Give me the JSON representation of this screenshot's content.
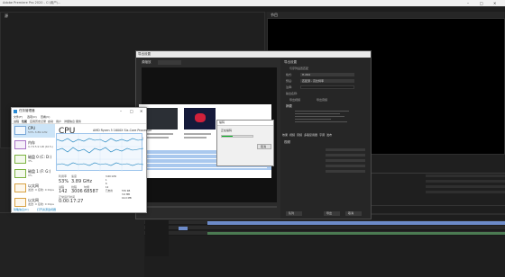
{
  "premiere": {
    "window_title": "Adobe Premiere Pro 2020 - C:\\用户\\...",
    "panels": {
      "program": "节目",
      "source": "源"
    }
  },
  "export_dialog": {
    "title": "导出设置",
    "source_scaling_label": "源缩放",
    "output_label": "输出",
    "export_settings_header": "导出设置",
    "match_sequence": "与序列设置匹配",
    "format_label": "格式:",
    "format_value": "H.264",
    "preset_label": "预设:",
    "preset_value": "匹配源 - 高比特率",
    "comment_label": "注释:",
    "output_name_label": "输出名称:",
    "export_video": "导出视频",
    "export_audio": "导出音频",
    "summary_header": "摘要",
    "tabs": [
      "效果",
      "视频",
      "音频",
      "多路复用器",
      "字幕",
      "发布"
    ],
    "video_header": "视频",
    "queue_button": "队列",
    "export_button": "导出",
    "cancel_button": "取消"
  },
  "progress_dialog": {
    "title": "编码",
    "label": "正在编码",
    "progress": 0.35,
    "cancel": "取消"
  },
  "task_manager": {
    "title": "任务管理器",
    "menu": [
      "文件(F)",
      "选项(O)",
      "查看(V)"
    ],
    "tabs": [
      "进程",
      "性能",
      "应用历史记录",
      "启动",
      "用户",
      "详细信息",
      "服务"
    ],
    "sidebar": [
      {
        "label": "CPU",
        "sub": "53% 3.89 GHz"
      },
      {
        "label": "内存",
        "sub": "9.7/15.9 GB (61%)"
      },
      {
        "label": "磁盘 0 (C: D:)",
        "sub": "3%"
      },
      {
        "label": "磁盘 1 (F: G:)",
        "sub": "0%"
      },
      {
        "label": "以太网",
        "sub": "发送: 0 接收: 0 Kbps"
      },
      {
        "label": "以太网",
        "sub": "发送: 0 接收: 0 Kbps"
      }
    ],
    "cpu_header": "CPU",
    "cpu_model": "AMD Ryzen 5 1600X Six-Core Processor",
    "graph_caption": "60 秒内的利用率 %",
    "graph_max": "100%",
    "stats": {
      "utilization_label": "利用率",
      "utilization": "53%",
      "speed_label": "速度",
      "speed": "3.89 GHz",
      "processes_label": "进程",
      "processes": "142",
      "threads_label": "线程",
      "threads": "3006",
      "handles_label": "句柄",
      "handles": "68587",
      "uptime_label": "正常运行时间",
      "uptime": "0:00:17:27"
    },
    "right_stats": {
      "base_speed": "3.60 GHz",
      "sockets": "1",
      "cores": "6",
      "logical": "12",
      "virtualization": "已启用",
      "l1": "576 KB",
      "l2": "3.0 MB",
      "l3": "16.0 MB"
    },
    "footer_less": "简略信息(D)",
    "footer_monitor": "打开资源监视器"
  },
  "colors": {
    "premiere_bg": "#232323",
    "progress_green": "#06b025",
    "tm_accent": "#117dbb",
    "timeline_clip": "#6d8bc9"
  }
}
